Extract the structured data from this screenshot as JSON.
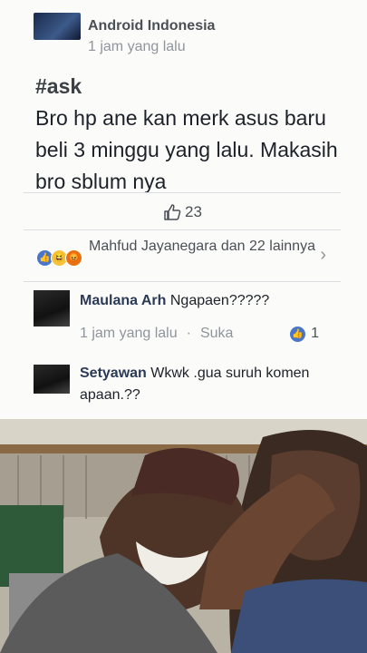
{
  "post": {
    "group_name": "Android Indonesia",
    "time": "1 jam yang lalu",
    "hashtag": "#ask",
    "body": "Bro hp ane kan merk asus baru beli 3 minggu yang lalu. Makasih bro sblum nya",
    "like_count": "23"
  },
  "reactions": {
    "text": "Mahfud Jayanegara dan 22 lainnya",
    "icons": [
      "like-icon",
      "haha-icon",
      "angry-icon"
    ]
  },
  "comments": [
    {
      "name": "Maulana Arh",
      "text": "Ngapaen?????",
      "time": "1 jam yang lalu",
      "action": "Suka",
      "likes": "1"
    },
    {
      "name": "Setyawan",
      "text": "Wkwk .gua suruh komen apaan.??"
    }
  ],
  "colors": {
    "accent": "#4a76c9",
    "text": "#1d2129",
    "muted": "#90949c"
  }
}
